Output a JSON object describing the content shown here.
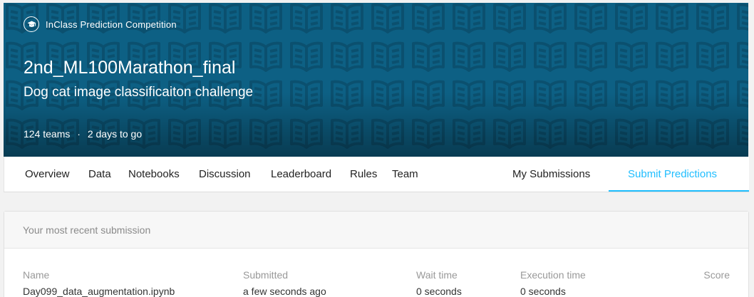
{
  "banner": {
    "competition_type": "InClass Prediction Competition",
    "title": "2nd_ML100Marathon_final",
    "subtitle": "Dog cat image classificaiton challenge",
    "teams": "124 teams",
    "separator": "·",
    "deadline": "2 days to go",
    "bg_color": "#0d6084"
  },
  "tabs": {
    "overview": "Overview",
    "data": "Data",
    "notebooks": "Notebooks",
    "discussion": "Discussion",
    "leaderboard": "Leaderboard",
    "rules": "Rules",
    "team": "Team",
    "my_submissions": "My Submissions",
    "submit_predictions": "Submit Predictions",
    "active_color": "#20beff"
  },
  "submission": {
    "header": "Your most recent submission",
    "columns": {
      "name": "Name",
      "submitted": "Submitted",
      "wait_time": "Wait time",
      "execution_time": "Execution time",
      "score": "Score"
    },
    "row": {
      "name": "Day099_data_augmentation.ipynb",
      "submitted": "a few seconds ago",
      "wait_time": "0 seconds",
      "execution_time": "0 seconds"
    }
  },
  "icons": {
    "competition": "graduation-cap-icon",
    "pattern": "open-book-icon"
  }
}
